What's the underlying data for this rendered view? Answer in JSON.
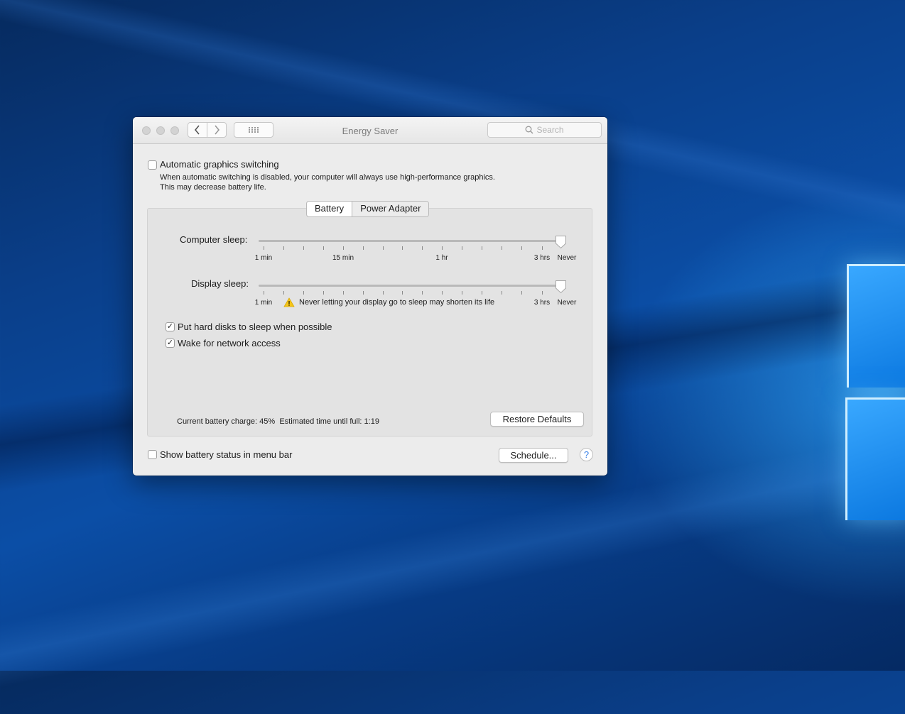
{
  "window": {
    "title": "Energy Saver"
  },
  "search": {
    "placeholder": "Search"
  },
  "graphics": {
    "label": "Automatic graphics switching",
    "checked": false,
    "description_line1": "When automatic switching is disabled, your computer will always use high-performance graphics.",
    "description_line2": "This may decrease battery life."
  },
  "tabs": {
    "battery": "Battery",
    "power_adapter": "Power Adapter",
    "selected": "Battery"
  },
  "computer_sleep": {
    "label": "Computer sleep:",
    "value": "Never",
    "ticks": [
      "1 min",
      "15 min",
      "1 hr",
      "3 hrs",
      "Never"
    ]
  },
  "display_sleep": {
    "label": "Display sleep:",
    "value": "Never",
    "tick_start": "1 min",
    "tick_3hrs": "3 hrs",
    "tick_never": "Never",
    "warning": "Never letting your display go to sleep may shorten its life",
    "warning_icon": "warning-triangle-icon"
  },
  "options": {
    "hard_disks": {
      "label": "Put hard disks to sleep when possible",
      "checked": true
    },
    "wake_network": {
      "label": "Wake for network access",
      "checked": true
    }
  },
  "status": {
    "charge": "Current battery charge: 45%",
    "estimate": "Estimated time until full: 1:19"
  },
  "buttons": {
    "restore_defaults": "Restore Defaults",
    "schedule": "Schedule...",
    "help": "?"
  },
  "menu_bar_status": {
    "label": "Show battery status in menu bar",
    "checked": false
  },
  "colors": {
    "accent": "#3b82e6",
    "warning": "#f5c518"
  }
}
